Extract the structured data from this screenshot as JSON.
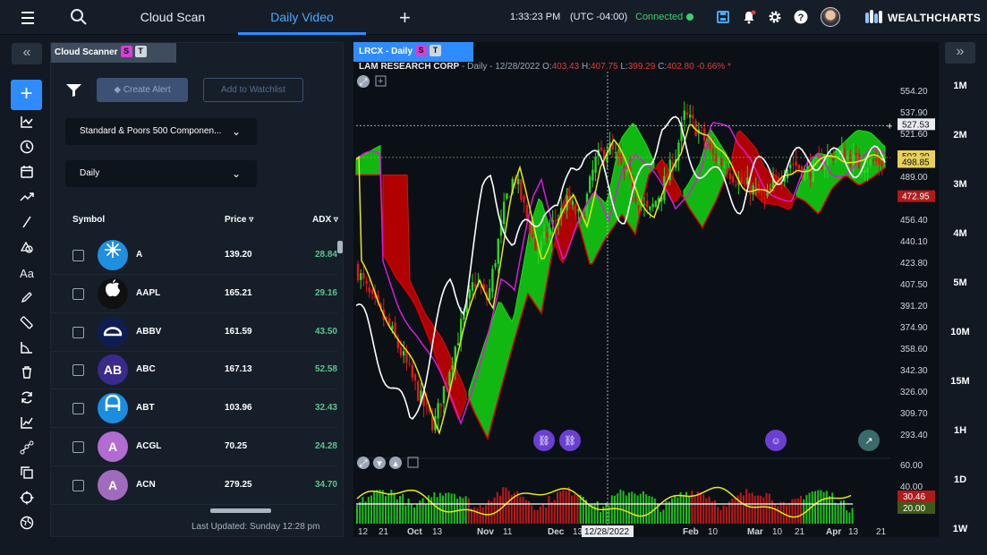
{
  "header": {
    "tabs": [
      {
        "label": "Cloud Scan",
        "active": false
      },
      {
        "label": "Daily Video",
        "active": true
      }
    ],
    "time": "1:33:23 PM",
    "timezone": "(UTC -04:00)",
    "connection": "Connected",
    "brand": "WEALTHCHARTS"
  },
  "scanner": {
    "tab_label": "Cloud Scanner",
    "badge_s": "S",
    "badge_t": "T",
    "create_alert": "Create Alert",
    "add_watchlist": "Add to Watchlist",
    "universe": "Standard & Poors 500 Componen...",
    "interval": "Daily",
    "columns": {
      "symbol": "Symbol",
      "price": "Price",
      "adx": "ADX"
    },
    "rows": [
      {
        "symbol": "A",
        "price": "139.20",
        "adx": "28.84",
        "logo_text": "",
        "logo_color": "#1f8fe0"
      },
      {
        "symbol": "AAPL",
        "price": "165.21",
        "adx": "29.16",
        "logo_text": "",
        "logo_color": "#101010"
      },
      {
        "symbol": "ABBV",
        "price": "161.59",
        "adx": "43.50",
        "logo_text": "",
        "logo_color": "#0f1d52"
      },
      {
        "symbol": "ABC",
        "price": "167.13",
        "adx": "52.58",
        "logo_text": "AB",
        "logo_color": "#3a2a8c"
      },
      {
        "symbol": "ABT",
        "price": "103.96",
        "adx": "32.43",
        "logo_text": "",
        "logo_color": "#1a8de0"
      },
      {
        "symbol": "ACGL",
        "price": "70.25",
        "adx": "24.28",
        "logo_text": "A",
        "logo_color": "#b16bd1"
      },
      {
        "symbol": "ACN",
        "price": "279.25",
        "adx": "34.70",
        "logo_text": "A",
        "logo_color": "#a06bbd"
      }
    ],
    "last_updated": "Last Updated: Sunday 12:28 pm"
  },
  "chart": {
    "tab_label": "LRCX - Daily",
    "badge_s": "S",
    "badge_t": "T",
    "company": "LAM RESEARCH CORP",
    "interval_date": " - Daily - 12/28/2022 ",
    "ohlc": {
      "open": "403.43",
      "high": "407.75",
      "low": "399.29",
      "close": "402.80",
      "change": "-0.66%"
    },
    "price_ticks": [
      "554.20",
      "537.90",
      "521.60",
      "505.30",
      "489.00",
      "472.70",
      "456.40",
      "440.10",
      "423.80",
      "407.50",
      "391.20",
      "374.90",
      "358.60",
      "342.30",
      "326.00",
      "309.70",
      "293.40"
    ],
    "price_labels": {
      "crosshair": "527.53",
      "last_a": "503.30",
      "last_b": "498.85",
      "cloud": "472.95"
    },
    "osc_ticks": [
      "60.00",
      "40.00"
    ],
    "osc_labels": {
      "adx": "30.46",
      "level": "20.00"
    },
    "x_ticks": [
      "12",
      "21",
      "Oct",
      "13",
      "Nov",
      "11",
      "Dec",
      "13",
      "Jan",
      "Feb",
      "10",
      "Mar",
      "10",
      "21",
      "Apr",
      "13",
      "21"
    ],
    "crosshair_date": "12/28/2022"
  },
  "timeframes": [
    "1M",
    "2M",
    "3M",
    "4M",
    "5M",
    "10M",
    "15M",
    "1H",
    "1D",
    "1W"
  ],
  "colors": {
    "accent": "#2f8cff",
    "connected": "#3cd070",
    "cloud_bull": "#12b812",
    "cloud_bear": "#b00000",
    "adx_positive": "#58c68a"
  }
}
